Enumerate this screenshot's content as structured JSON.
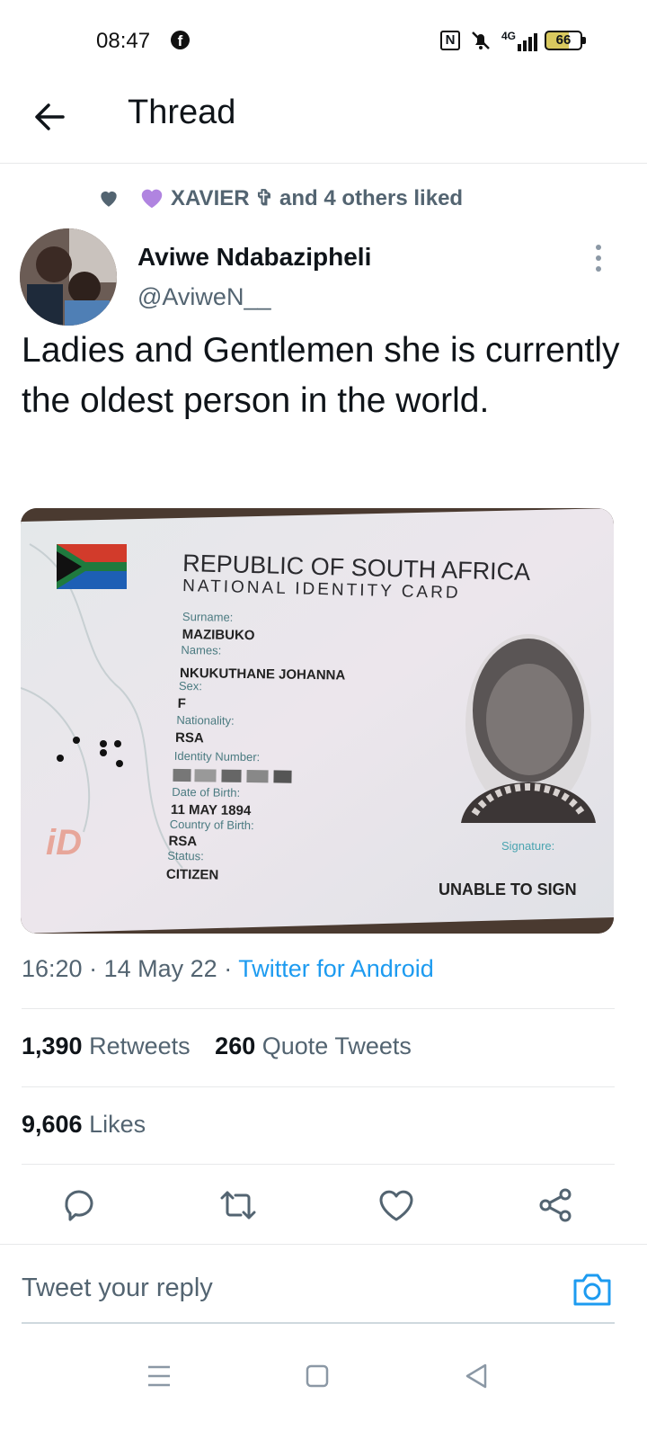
{
  "status_bar": {
    "time": "08:47",
    "facebook_glyph": "f",
    "nfc_glyph": "N",
    "network": "4G",
    "battery": "66"
  },
  "header": {
    "title": "Thread"
  },
  "social_context": {
    "text": "XAVIER ✞ and 4 others liked"
  },
  "tweet": {
    "author_name": "Aviwe Ndabazipheli",
    "author_handle": "@AviweN__",
    "text": "Ladies and Gentlemen she is currently the oldest person in the world.",
    "time": "16:20",
    "separator": "·",
    "date": "14 May 22",
    "source": "Twitter for Android"
  },
  "id_card": {
    "heading_1": "REPUBLIC OF SOUTH AFRICA",
    "heading_2": "NATIONAL IDENTITY CARD",
    "surname_label": "Surname:",
    "surname": "MAZIBUKO",
    "names_label": "Names:",
    "names": "NKUKUTHANE JOHANNA",
    "sex_label": "Sex:",
    "sex": "F",
    "nationality_label": "Nationality:",
    "nationality": "RSA",
    "id_label": "Identity Number:",
    "dob_label": "Date of Birth:",
    "dob": "11 MAY 1894",
    "country_label": "Country of Birth:",
    "country": "RSA",
    "status_label": "Status:",
    "status": "CITIZEN",
    "signature_label": "Signature:",
    "signature": "UNABLE TO SIGN",
    "logo": "iD"
  },
  "stats": {
    "retweets_count": "1,390",
    "retweets_label": "Retweets",
    "quotes_count": "260",
    "quotes_label": "Quote Tweets",
    "likes_count": "9,606",
    "likes_label": "Likes"
  },
  "reply": {
    "placeholder": "Tweet your reply"
  },
  "colors": {
    "link": "#1d9bf0",
    "secondary_text": "#536471",
    "purple_heart": "#b084e0"
  }
}
